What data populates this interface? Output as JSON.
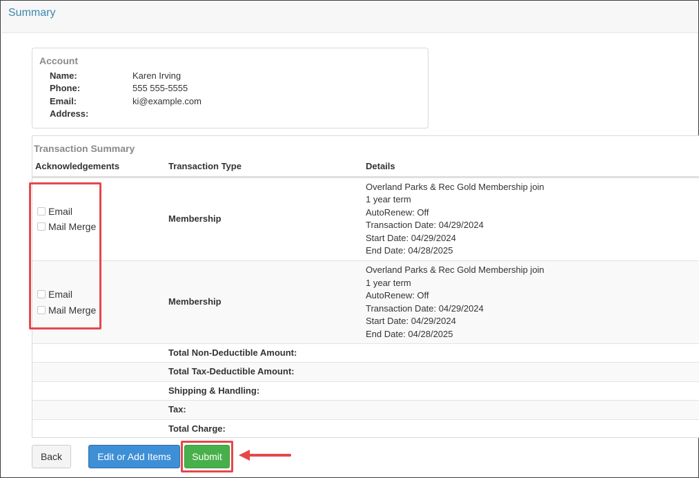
{
  "page": {
    "title": "Summary"
  },
  "account": {
    "title": "Account",
    "fields": [
      {
        "label": "Name:",
        "value": "Karen Irving"
      },
      {
        "label": "Phone:",
        "value": "555 555-5555"
      },
      {
        "label": "Email:",
        "value": "ki@example.com"
      },
      {
        "label": "Address:",
        "value": ""
      }
    ]
  },
  "transaction_summary": {
    "title": "Transaction Summary",
    "columns": [
      "Acknowledgements",
      "Transaction Type",
      "Details"
    ],
    "rows": [
      {
        "acknowledgements": [
          {
            "label": "Email",
            "checked": false
          },
          {
            "label": "Mail Merge",
            "checked": false
          }
        ],
        "type": "Membership",
        "details": [
          "Overland Parks & Rec Gold Membership  join",
          "1  year   term",
          "AutoRenew:  Off",
          "Transaction Date: 04/29/2024",
          "Start Date: 04/29/2024",
          "End Date: 04/28/2025"
        ]
      },
      {
        "acknowledgements": [
          {
            "label": "Email",
            "checked": false
          },
          {
            "label": "Mail Merge",
            "checked": false
          }
        ],
        "type": "Membership",
        "details": [
          "Overland Parks & Rec Gold Membership  join",
          "1  year   term",
          "AutoRenew:  Off",
          "Transaction Date: 04/29/2024",
          "Start Date: 04/29/2024",
          "End Date: 04/28/2025"
        ]
      }
    ],
    "totals": [
      "Total Non-Deductible Amount:",
      "Total Tax-Deductible Amount:",
      "Shipping & Handling:",
      "Tax:",
      "Total Charge:"
    ]
  },
  "buttons": {
    "back": "Back",
    "edit": "Edit or Add Items",
    "submit": "Submit"
  },
  "colors": {
    "title": "#3a87ad",
    "highlight": "#e5474b",
    "edit_button": "#3d8fd6",
    "submit_button": "#48b04a"
  }
}
